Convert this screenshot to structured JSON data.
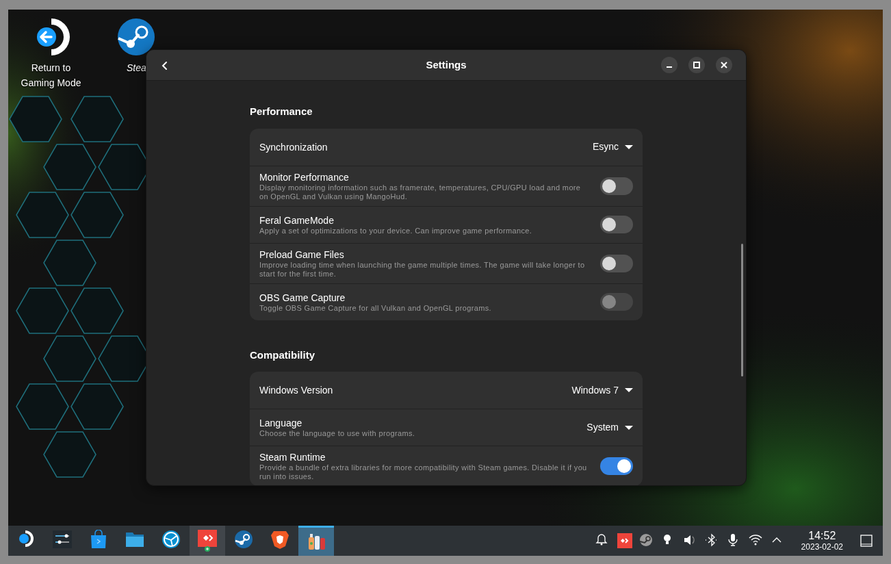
{
  "desktop_icons": [
    {
      "label": "Return to Gaming Mode",
      "italic": false
    },
    {
      "label": "Stea",
      "italic": true
    }
  ],
  "window": {
    "title": "Settings"
  },
  "sections": [
    {
      "title": "Performance",
      "rows": [
        {
          "kind": "dropdown",
          "label": "Synchronization",
          "value": "Esync"
        },
        {
          "kind": "toggle",
          "label": "Monitor Performance",
          "description": "Display monitoring information such as framerate, temperatures, CPU/GPU load and more on OpenGL and Vulkan using MangoHud.",
          "on": false,
          "disabled": false
        },
        {
          "kind": "toggle",
          "label": "Feral GameMode",
          "description": "Apply a set of optimizations to your device. Can improve game performance.",
          "on": false,
          "disabled": false
        },
        {
          "kind": "toggle",
          "label": "Preload Game Files",
          "description": "Improve loading time when launching the game multiple times. The game will take longer to start for the first time.",
          "on": false,
          "disabled": false
        },
        {
          "kind": "toggle",
          "label": "OBS Game Capture",
          "description": "Toggle OBS Game Capture for all Vulkan and OpenGL programs.",
          "on": false,
          "disabled": true
        }
      ]
    },
    {
      "title": "Compatibility",
      "rows": [
        {
          "kind": "dropdown",
          "label": "Windows Version",
          "value": "Windows 7"
        },
        {
          "kind": "dropdown",
          "label": "Language",
          "description": "Choose the language to use with programs.",
          "value": "System"
        },
        {
          "kind": "toggle",
          "label": "Steam Runtime",
          "description": "Provide a bundle of extra libraries for more compatibility with Steam games. Disable it if you run into issues.",
          "on": true,
          "disabled": false
        }
      ]
    }
  ],
  "taskbar": {
    "apps": [
      {
        "selected": false,
        "highlighted": false
      },
      {
        "selected": false,
        "highlighted": false
      },
      {
        "selected": false,
        "highlighted": false
      },
      {
        "selected": false,
        "highlighted": false
      },
      {
        "selected": false,
        "highlighted": false
      },
      {
        "selected": false,
        "highlighted": true
      },
      {
        "selected": false,
        "highlighted": false
      },
      {
        "selected": false,
        "highlighted": false
      },
      {
        "selected": true,
        "highlighted": false
      }
    ],
    "time": "14:52",
    "date": "2023-02-02"
  }
}
